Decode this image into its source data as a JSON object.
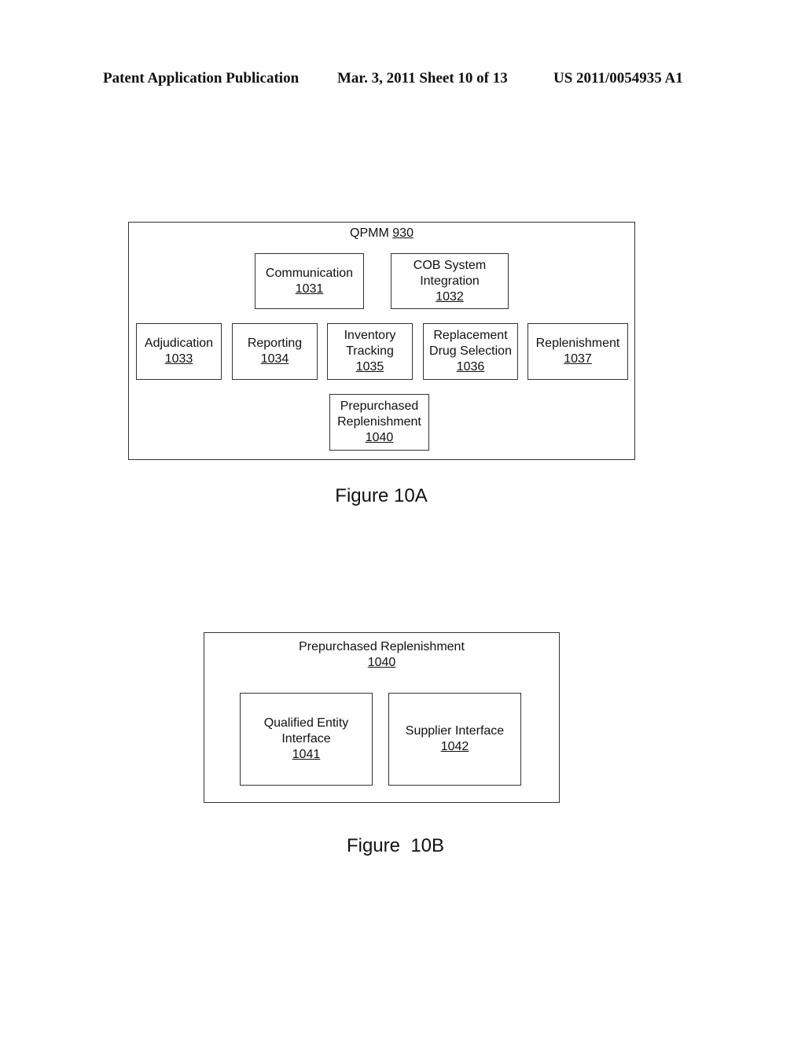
{
  "header": {
    "left": "Patent Application Publication",
    "middle": "Mar. 3, 2011   Sheet 10 of 13",
    "right": "US 2011/0054935 A1"
  },
  "figure_10a": {
    "container": {
      "label": "QPMM",
      "number": "930"
    },
    "modules": [
      {
        "lines": [
          "Communication"
        ],
        "number": "1031"
      },
      {
        "lines": [
          "COB System",
          "Integration"
        ],
        "number": "1032"
      },
      {
        "lines": [
          "Adjudication"
        ],
        "number": "1033"
      },
      {
        "lines": [
          "Reporting"
        ],
        "number": "1034"
      },
      {
        "lines": [
          "Inventory",
          "Tracking"
        ],
        "number": "1035"
      },
      {
        "lines": [
          "Replacement",
          "Drug Selection"
        ],
        "number": "1036"
      },
      {
        "lines": [
          "Replenishment"
        ],
        "number": "1037"
      },
      {
        "lines": [
          "Prepurchased",
          "Replenishment"
        ],
        "number": "1040"
      }
    ],
    "caption": "Figure 10A"
  },
  "figure_10b": {
    "container": {
      "label": "Prepurchased Replenishment",
      "number": "1040"
    },
    "modules": [
      {
        "lines": [
          "Qualified Entity",
          "Interface"
        ],
        "number": "1041"
      },
      {
        "lines": [
          "Supplier Interface"
        ],
        "number": "1042"
      }
    ],
    "caption": "Figure  10B"
  }
}
